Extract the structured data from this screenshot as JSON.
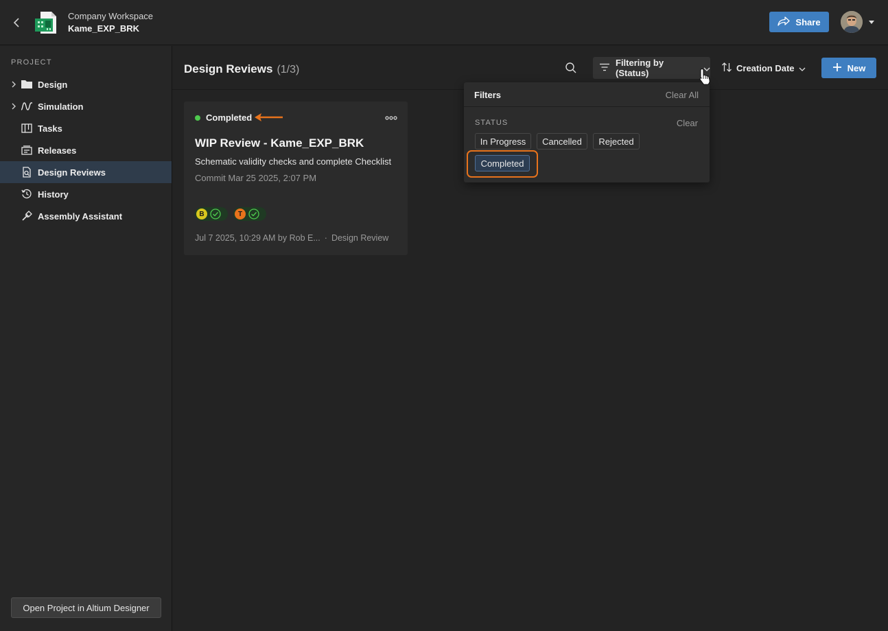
{
  "header": {
    "workspace": "Company Workspace",
    "project": "Kame_EXP_BRK",
    "share_label": "Share",
    "icons": {
      "back": "chevron-left-icon",
      "project": "pcb-project-icon",
      "share": "share-arrow-icon",
      "caret": "caret-down-icon"
    }
  },
  "sidebar": {
    "heading": "PROJECT",
    "items": [
      {
        "label": "Design",
        "icon": "folder-icon",
        "expandable": true,
        "active": false
      },
      {
        "label": "Simulation",
        "icon": "waveform-icon",
        "expandable": true,
        "active": false
      },
      {
        "label": "Tasks",
        "icon": "kanban-icon",
        "expandable": false,
        "active": false
      },
      {
        "label": "Releases",
        "icon": "releases-icon",
        "expandable": false,
        "active": false
      },
      {
        "label": "Design Reviews",
        "icon": "document-search-icon",
        "expandable": false,
        "active": true
      },
      {
        "label": "History",
        "icon": "history-icon",
        "expandable": false,
        "active": false
      },
      {
        "label": "Assembly Assistant",
        "icon": "assembly-tool-icon",
        "expandable": false,
        "active": false
      }
    ],
    "open_button": "Open Project in Altium Designer"
  },
  "main": {
    "title": "Design Reviews",
    "count": "(1/3)",
    "filter_label": "Filtering by (Status)",
    "sort_label": "Creation Date",
    "new_label": "New"
  },
  "card": {
    "status": "Completed",
    "status_color": "#4ec94e",
    "title": "WIP Review - Kame_EXP_BRK",
    "description": "Schematic validity checks and complete Checklist",
    "commit": "Commit Mar 25 2025, 2:07 PM",
    "reviewers": [
      {
        "initial": "B",
        "color": "#d8c81e"
      },
      {
        "initial": "T",
        "color": "#e8731c"
      }
    ],
    "footer_date": "Jul 7 2025, 10:29 AM by Rob E...",
    "footer_separator": "·",
    "footer_type": "Design Review"
  },
  "filters": {
    "title": "Filters",
    "clear_all": "Clear All",
    "section": "STATUS",
    "clear": "Clear",
    "options": [
      {
        "label": "In Progress",
        "selected": false
      },
      {
        "label": "Cancelled",
        "selected": false
      },
      {
        "label": "Rejected",
        "selected": false
      },
      {
        "label": "Completed",
        "selected": true
      }
    ]
  },
  "colors": {
    "accent": "#3f7fc1",
    "annotation": "#e8731c",
    "active_nav": "#2f3c4b"
  }
}
